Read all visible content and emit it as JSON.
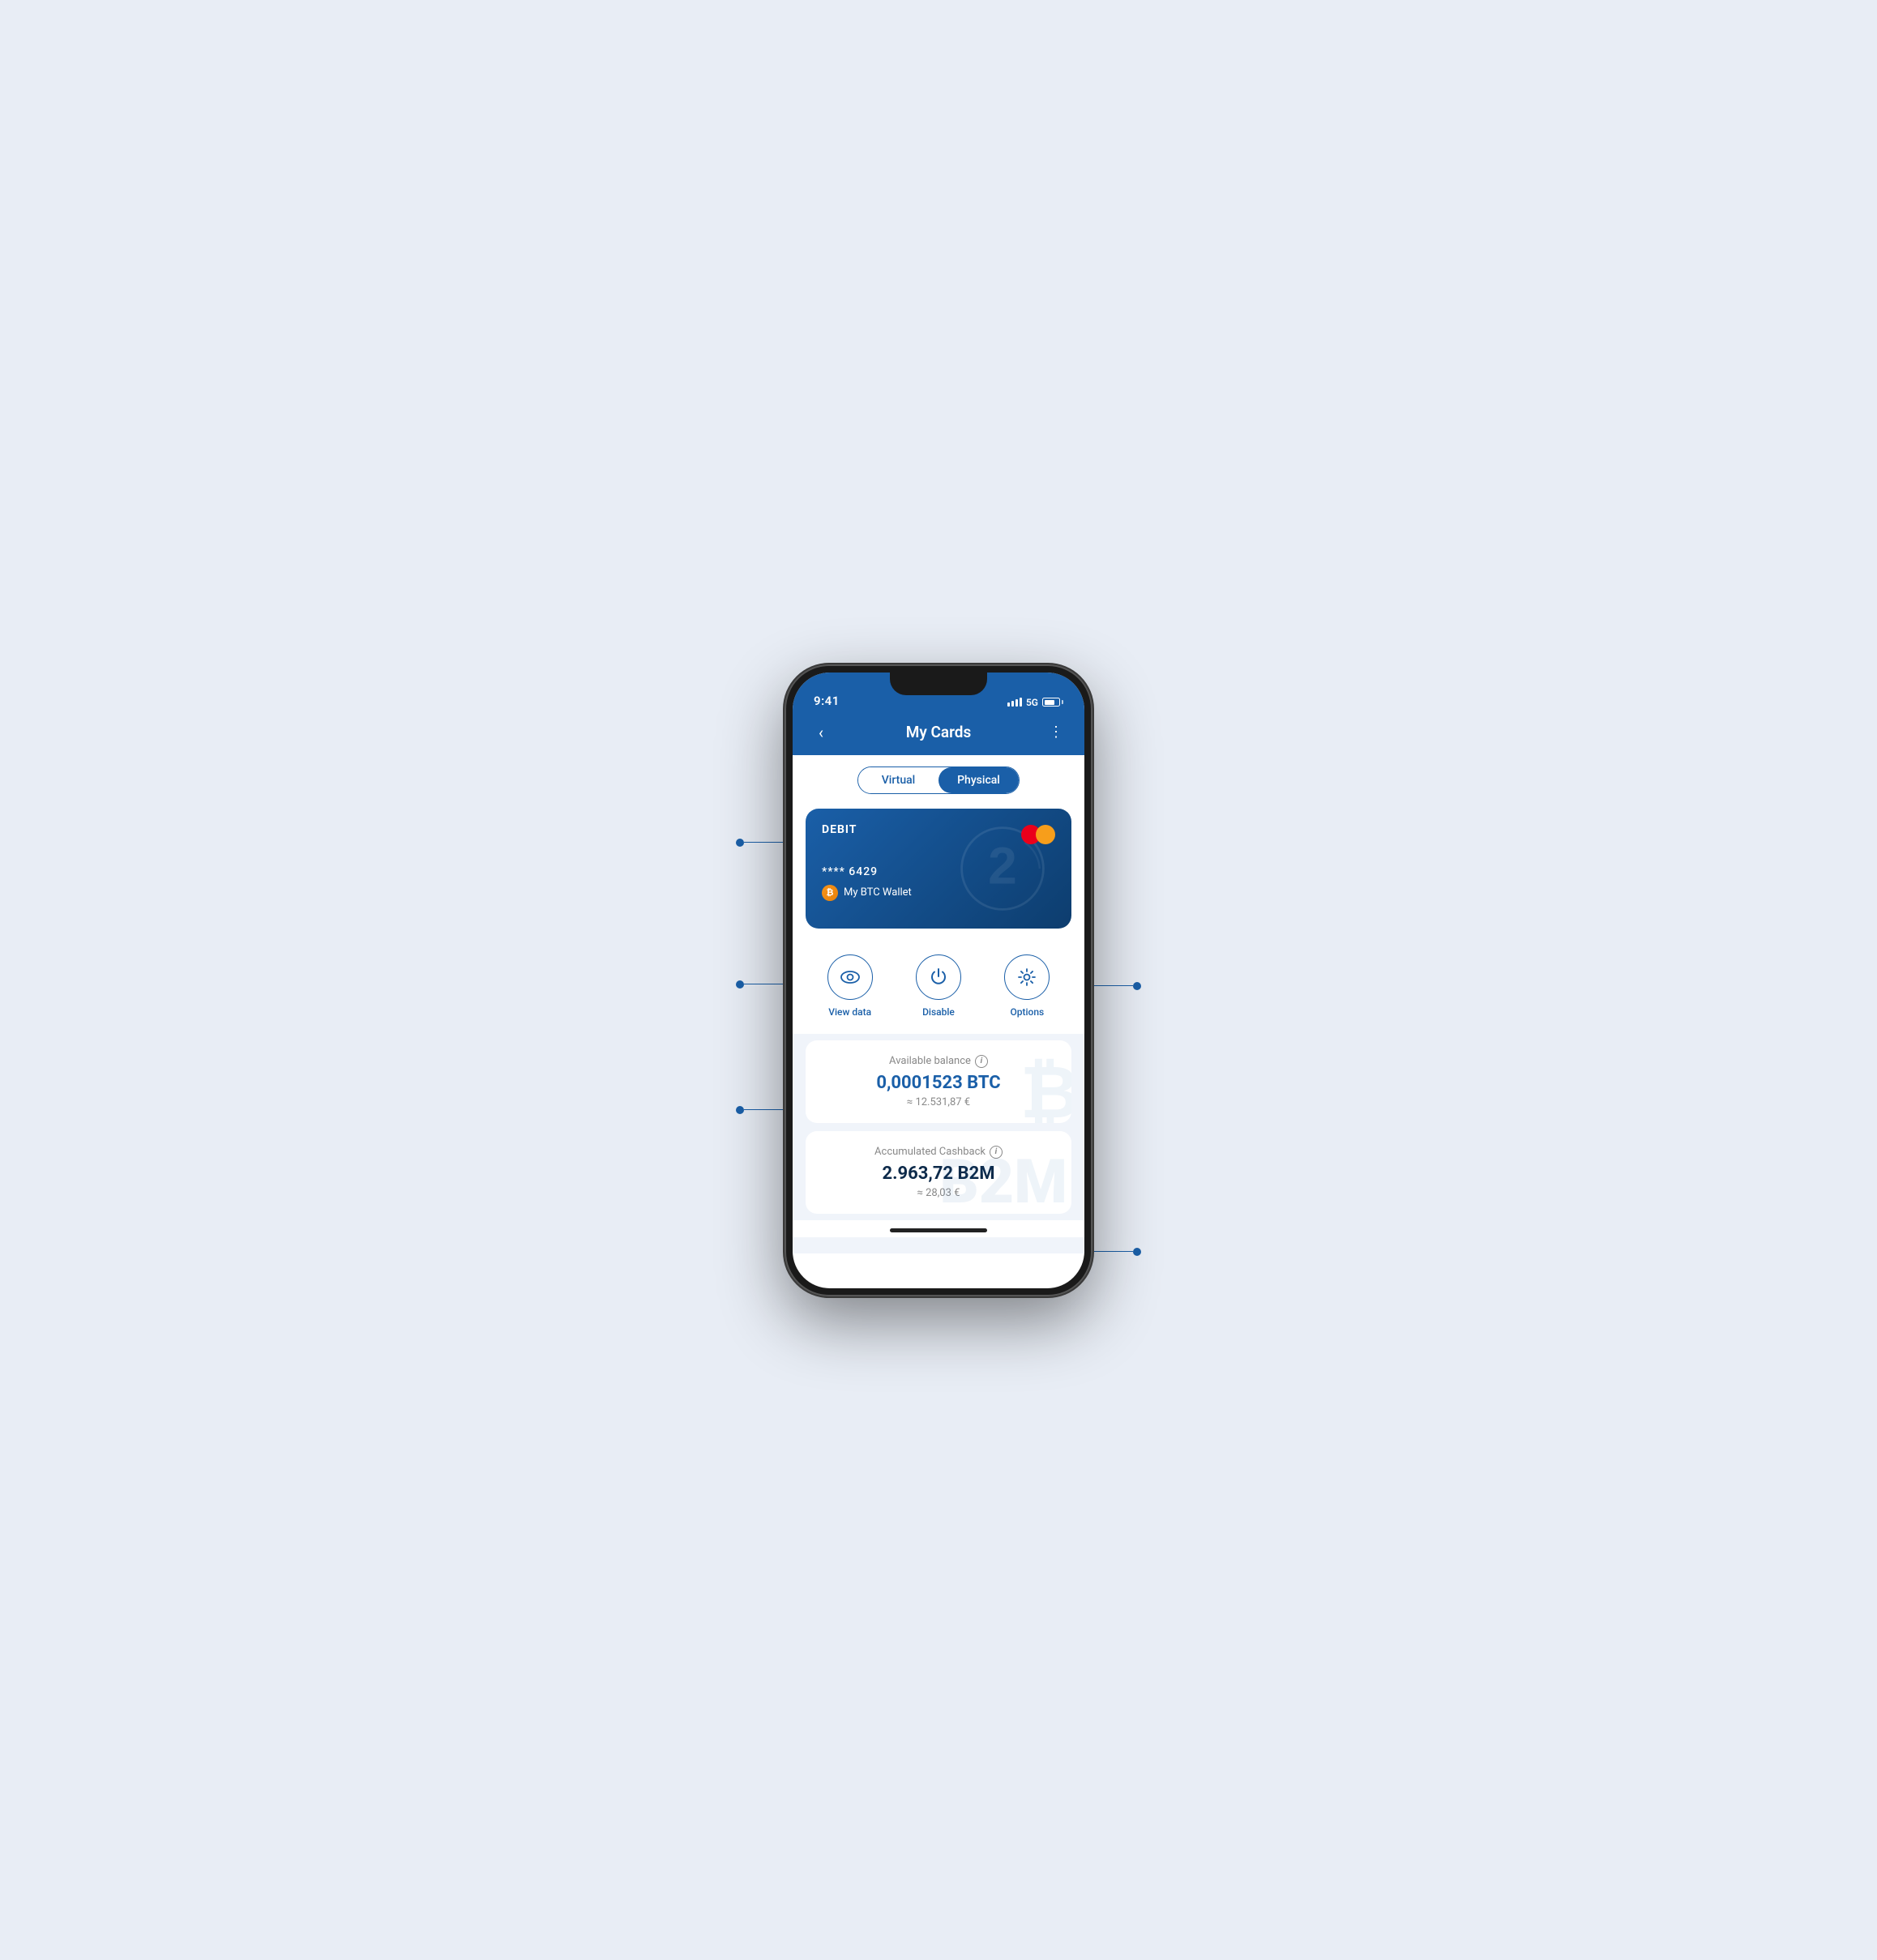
{
  "status_bar": {
    "time": "9:41",
    "network": "5G"
  },
  "header": {
    "title": "My Cards",
    "back_label": "‹",
    "more_label": "⋮"
  },
  "tabs": {
    "virtual_label": "Virtual",
    "physical_label": "Physical",
    "active": "physical"
  },
  "card": {
    "type_label": "DEBIT",
    "number": "**** 6429",
    "wallet_name": "My BTC Wallet",
    "btc_symbol": "₿"
  },
  "actions": [
    {
      "id": "view-data",
      "label": "View data",
      "icon": "eye"
    },
    {
      "id": "disable",
      "label": "Disable",
      "icon": "power"
    },
    {
      "id": "options",
      "label": "Options",
      "icon": "gear"
    }
  ],
  "balance_section": {
    "label": "Available balance",
    "main_value": "0,0001523 BTC",
    "sub_value": "≈ 12.531,87 €"
  },
  "cashback_section": {
    "label": "Accumulated Cashback",
    "main_value": "2.963,72 B2M",
    "sub_value": "≈ 28,03 €"
  },
  "colors": {
    "primary": "#1a5fa8",
    "dark_blue": "#0d3d6e",
    "text_dark": "#0d2a4a",
    "text_muted": "#888888",
    "background": "#f0f4fa",
    "white": "#ffffff"
  }
}
